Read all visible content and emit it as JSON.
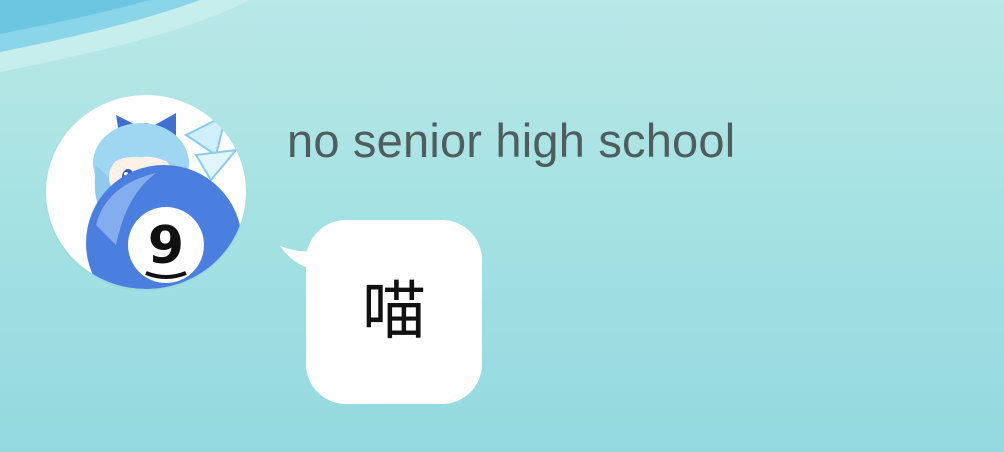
{
  "chat": {
    "sender": {
      "name": "no senior high school",
      "avatar_icon": "cirno-nine-ball-avatar-icon"
    },
    "message": {
      "text": "喵"
    }
  },
  "colors": {
    "background_top": "#b9e8e6",
    "background_bottom": "#93d9e0",
    "bubble": "#ffffff",
    "username_text": "#4f5d5f",
    "message_text": "#111111"
  }
}
